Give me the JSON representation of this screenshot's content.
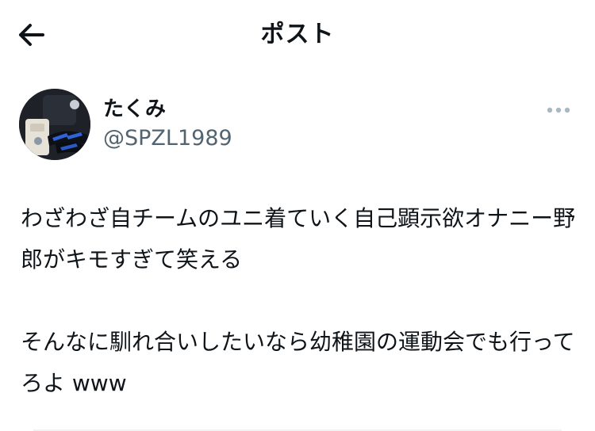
{
  "header": {
    "back_icon": "arrow-left-icon",
    "title": "ポスト"
  },
  "tweet": {
    "author": {
      "display_name": "たくみ",
      "handle": "@SPZL1989",
      "avatar_icon": "profile-photo"
    },
    "more_icon": "more-horizontal-icon",
    "text": "わざわざ自チームのユニ着ていく自己顕示欲オナニー野郎がキモすぎて笑える\n\nそんなに馴れ合いしたいなら幼稚園の運動会でも行ってろよ www"
  },
  "colors": {
    "text_primary": "#0f1419",
    "text_secondary": "#536471",
    "icon_muted": "#aab8c2",
    "background": "#ffffff"
  }
}
